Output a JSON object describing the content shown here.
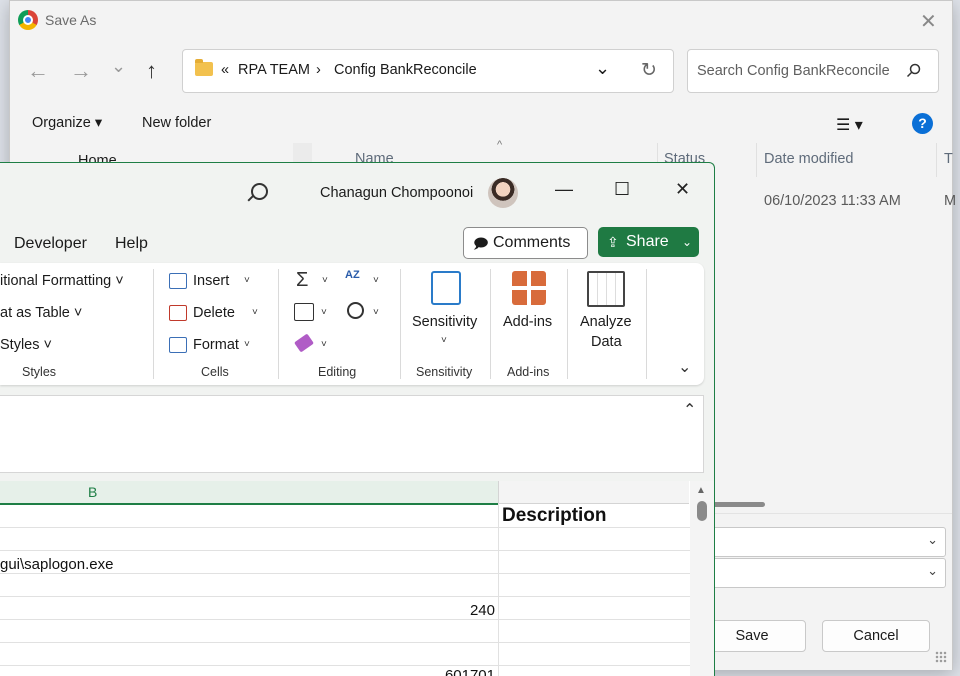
{
  "save_dialog": {
    "title": "Save As",
    "close_glyph": "✕",
    "nav": {
      "back": "←",
      "forward": "→",
      "recent": "⌄",
      "up": "↑"
    },
    "address": {
      "prefix": "«",
      "crumbs": [
        "RPA TEAM",
        "Config BankReconcile"
      ],
      "separator": "›",
      "dropdown": "⌄",
      "refresh": "↻"
    },
    "search_placeholder": "Search Config BankReconcile",
    "toolbar": {
      "organize": "Organize ▾",
      "new_folder": "New folder",
      "view": "☰ ▾",
      "help": "?"
    },
    "sidebar_peek": "Home",
    "columns": {
      "name": "Name",
      "status": "Status",
      "date_modified": "Date modified",
      "type": "T"
    },
    "file_row": {
      "date": "06/10/2023 11:33 AM",
      "type_peek": "M"
    },
    "buttons": {
      "save": "Save",
      "cancel": "Cancel"
    }
  },
  "excel": {
    "user_name": "Chanagun Chompoonoi",
    "window_controls": {
      "minimize": "—",
      "maximize": "☐",
      "close": "✕"
    },
    "menu": [
      "Developer",
      "Help"
    ],
    "comments_label": "Comments",
    "share_label": "Share",
    "ribbon": {
      "styles": {
        "items": [
          "itional Formatting ˅",
          "at as Table ˅",
          "Styles ˅"
        ],
        "group": "Styles"
      },
      "cells": {
        "items": [
          "Insert",
          "Delete",
          "Format"
        ],
        "group": "Cells"
      },
      "editing": {
        "group": "Editing",
        "autosum": "Σ",
        "sort": "AZ"
      },
      "sensitivity": {
        "label": "Sensitivity",
        "group": "Sensitivity"
      },
      "addins": {
        "label": "Add-ins",
        "group": "Add-ins"
      },
      "analyze": {
        "label1": "Analyze",
        "label2": "Data"
      },
      "collapse": "⌄"
    },
    "formula_bar_toggle": "⌃",
    "sheet": {
      "column_b": "B",
      "column_c_header": "Description",
      "cells": [
        "gui\\saplogon.exe",
        "240",
        "601701"
      ]
    }
  }
}
